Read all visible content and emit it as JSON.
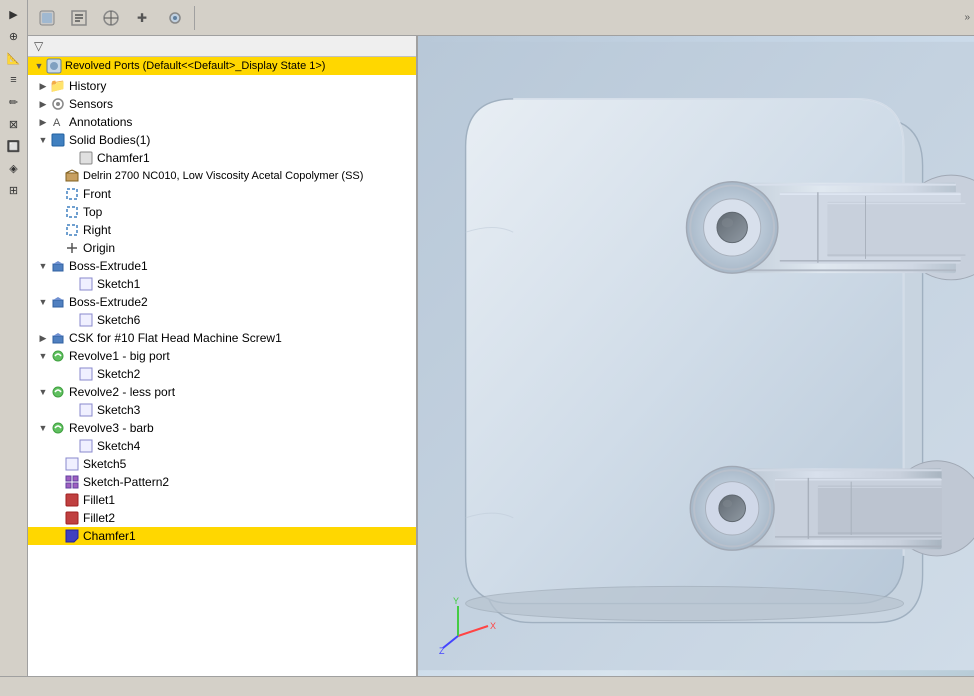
{
  "toolbar": {
    "tabs": [
      {
        "label": "⚙",
        "title": "Features"
      },
      {
        "label": "📋",
        "title": "PropertyManager"
      },
      {
        "label": "💾",
        "title": "ConfigurationManager"
      },
      {
        "label": "✚",
        "title": "DimXpertManager"
      },
      {
        "label": "🎨",
        "title": "DisplayManager"
      }
    ],
    "expand_label": "»"
  },
  "filter": {
    "icon": "🔽"
  },
  "tree": {
    "root_label": "Revolved Ports  (Default<<Default>_Display State 1>)",
    "items": [
      {
        "id": "history",
        "label": "History",
        "level": 1,
        "arrow": "collapsed",
        "icon": "folder"
      },
      {
        "id": "sensors",
        "label": "Sensors",
        "level": 1,
        "arrow": "collapsed",
        "icon": "sensor"
      },
      {
        "id": "annotations",
        "label": "Annotations",
        "level": 1,
        "arrow": "collapsed",
        "icon": "annotation"
      },
      {
        "id": "solid-bodies",
        "label": "Solid Bodies(1)",
        "level": 1,
        "arrow": "expanded",
        "icon": "solid"
      },
      {
        "id": "chamfer1-body",
        "label": "Chamfer1",
        "level": 2,
        "arrow": "none",
        "icon": "part"
      },
      {
        "id": "material",
        "label": "Delrin 2700 NC010, Low Viscosity Acetal Copolymer (SS)",
        "level": 1,
        "arrow": "none",
        "icon": "material"
      },
      {
        "id": "front",
        "label": "Front",
        "level": 1,
        "arrow": "none",
        "icon": "plane"
      },
      {
        "id": "top",
        "label": "Top",
        "level": 1,
        "arrow": "none",
        "icon": "plane"
      },
      {
        "id": "right",
        "label": "Right",
        "level": 1,
        "arrow": "none",
        "icon": "plane"
      },
      {
        "id": "origin",
        "label": "Origin",
        "level": 1,
        "arrow": "none",
        "icon": "plane"
      },
      {
        "id": "boss-extrude1",
        "label": "Boss-Extrude1",
        "level": 1,
        "arrow": "expanded",
        "icon": "feature"
      },
      {
        "id": "sketch1",
        "label": "Sketch1",
        "level": 2,
        "arrow": "none",
        "icon": "sketch"
      },
      {
        "id": "boss-extrude2",
        "label": "Boss-Extrude2",
        "level": 1,
        "arrow": "expanded",
        "icon": "feature"
      },
      {
        "id": "sketch6",
        "label": "Sketch6",
        "level": 2,
        "arrow": "none",
        "icon": "sketch"
      },
      {
        "id": "csk",
        "label": "CSK for #10 Flat Head Machine Screw1",
        "level": 1,
        "arrow": "collapsed",
        "icon": "feature"
      },
      {
        "id": "revolve1",
        "label": "Revolve1 - big port",
        "level": 1,
        "arrow": "expanded",
        "icon": "revolve"
      },
      {
        "id": "sketch2",
        "label": "Sketch2",
        "level": 2,
        "arrow": "none",
        "icon": "sketch"
      },
      {
        "id": "revolve2",
        "label": "Revolve2 - less port",
        "level": 1,
        "arrow": "expanded",
        "icon": "revolve"
      },
      {
        "id": "sketch3",
        "label": "Sketch3",
        "level": 2,
        "arrow": "none",
        "icon": "sketch"
      },
      {
        "id": "revolve3",
        "label": "Revolve3 - barb",
        "level": 1,
        "arrow": "expanded",
        "icon": "revolve"
      },
      {
        "id": "sketch4",
        "label": "Sketch4",
        "level": 2,
        "arrow": "none",
        "icon": "sketch"
      },
      {
        "id": "sketch5",
        "label": "Sketch5",
        "level": 1,
        "arrow": "none",
        "icon": "sketch"
      },
      {
        "id": "sketch-pattern2",
        "label": "Sketch-Pattern2",
        "level": 1,
        "arrow": "none",
        "icon": "pattern"
      },
      {
        "id": "fillet1",
        "label": "Fillet1",
        "level": 1,
        "arrow": "none",
        "icon": "fillet"
      },
      {
        "id": "fillet2",
        "label": "Fillet2",
        "level": 1,
        "arrow": "none",
        "icon": "fillet"
      },
      {
        "id": "chamfer1",
        "label": "Chamfer1",
        "level": 1,
        "arrow": "none",
        "icon": "chamfer",
        "selected": true
      }
    ]
  },
  "left_toolbar_icons": [
    "▶",
    "⊕",
    "📐",
    "≡",
    "✏",
    "⊠",
    "🔲",
    "◈",
    "⊞"
  ],
  "status_bar": {
    "text": ""
  }
}
